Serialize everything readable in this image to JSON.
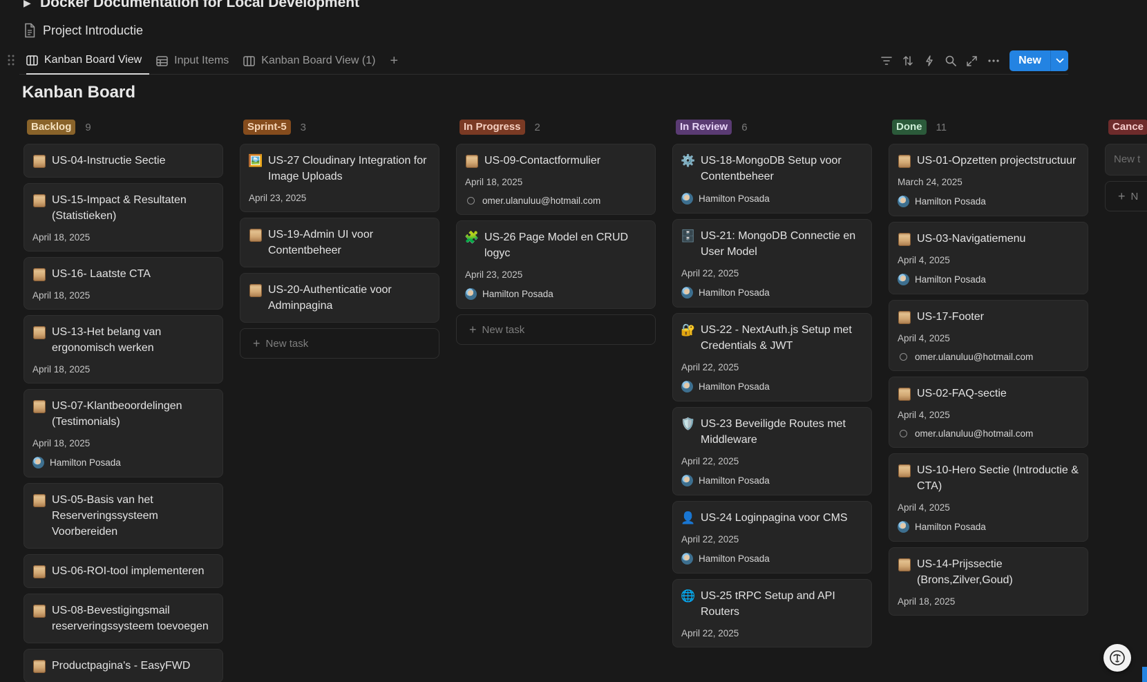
{
  "header": {
    "parent_title": "Docker Documentation for Local Development",
    "page_title": "Project Introductie"
  },
  "tabs": [
    {
      "label": "Kanban Board View",
      "icon": "board-icon",
      "active": true
    },
    {
      "label": "Input Items",
      "icon": "table-icon",
      "active": false
    },
    {
      "label": "Kanban Board View (1)",
      "icon": "board-icon",
      "active": false
    }
  ],
  "toolbar": {
    "new_label": "New",
    "tools": [
      "filter-icon",
      "sort-icon",
      "automation-icon",
      "search-icon",
      "expand-icon",
      "more-icon"
    ]
  },
  "board_title": "Kanban Board",
  "new_task_label": "New task",
  "new_task_short": "New t",
  "new_short": "N",
  "columns": [
    {
      "name": "Backlog",
      "count": "9",
      "badge_bg": "#89632a",
      "badge_fg": "#f5e2c0",
      "cards": [
        {
          "title": "US-04-Instructie Sectie",
          "icon": "scroll"
        },
        {
          "title": "US-15-Impact & Resultaten (Statistieken)",
          "icon": "scroll",
          "date": "April 18, 2025"
        },
        {
          "title": "US-16- Laatste CTA",
          "icon": "scroll",
          "date": "April 18, 2025"
        },
        {
          "title": "US-13-Het belang van ergonomisch werken",
          "icon": "scroll",
          "date": "April 18, 2025"
        },
        {
          "title": "US-07-Klantbeoordelingen (Testimonials)",
          "icon": "scroll",
          "date": "April 18, 2025",
          "person": "Hamilton Posada",
          "avatar": true
        },
        {
          "title": "US-05-Basis van het Reserveringssysteem Voorbereiden",
          "icon": "scroll"
        },
        {
          "title": "US-06-ROI-tool implementeren",
          "icon": "scroll"
        },
        {
          "title": "US-08-Bevestigingsmail reserveringssysteem toevoegen",
          "icon": "scroll"
        },
        {
          "title": "Productpagina's - EasyFWD",
          "icon": "scroll"
        }
      ]
    },
    {
      "name": "Sprint-5",
      "count": "3",
      "badge_bg": "#854c1d",
      "badge_fg": "#f6d6b8",
      "cards": [
        {
          "title": "US-27 Cloudinary Integration for Image Uploads",
          "icon": "picture",
          "date": "April 23, 2025"
        },
        {
          "title": "US-19-Admin UI voor Contentbeheer",
          "icon": "scroll"
        },
        {
          "title": "US-20-Authenticatie voor Adminpagina",
          "icon": "scroll"
        }
      ],
      "new_task": true
    },
    {
      "name": "In Progress",
      "count": "2",
      "badge_bg": "#7a3a24",
      "badge_fg": "#f5cfc0",
      "cards": [
        {
          "title": "US-09-Contactformulier",
          "icon": "scroll",
          "date": "April 18, 2025",
          "person": "omer.ulanuluu@hotmail.com",
          "avatar": false
        },
        {
          "title": "US-26 Page Model en CRUD logyc",
          "icon": "puzzle",
          "date": "April 23, 2025",
          "person": "Hamilton Posada",
          "avatar": true
        }
      ],
      "new_task": true
    },
    {
      "name": "In Review",
      "count": "6",
      "badge_bg": "#5a3b73",
      "badge_fg": "#e8d5f7",
      "cards": [
        {
          "title": "US-18-MongoDB Setup voor Contentbeheer",
          "icon": "gear",
          "person": "Hamilton Posada",
          "avatar": true
        },
        {
          "title": "US-21: MongoDB Connectie en User Model",
          "icon": "cabinet",
          "date": "April 22, 2025",
          "person": "Hamilton Posada",
          "avatar": true
        },
        {
          "title": "US-22 - NextAuth.js Setup met Credentials & JWT",
          "icon": "lock",
          "date": "April 22, 2025",
          "person": "Hamilton Posada",
          "avatar": true
        },
        {
          "title": "US-23 Beveiligde Routes met Middleware",
          "icon": "shield",
          "date": "April 22, 2025",
          "person": "Hamilton Posada",
          "avatar": true
        },
        {
          "title": "US-24 Loginpagina voor CMS",
          "icon": "user",
          "date": "April 22, 2025",
          "person": "Hamilton Posada",
          "avatar": true
        },
        {
          "title": "US-25 tRPC Setup and API Routers",
          "icon": "globe",
          "date": "April 22, 2025"
        }
      ]
    },
    {
      "name": "Done",
      "count": "11",
      "badge_bg": "#2b5a3a",
      "badge_fg": "#cdeed7",
      "cards": [
        {
          "title": "US-01-Opzetten projectstructuur",
          "icon": "scroll",
          "date": "March 24, 2025",
          "person": "Hamilton Posada",
          "avatar": true
        },
        {
          "title": "US-03-Navigatiemenu",
          "icon": "scroll",
          "date": "April 4, 2025",
          "person": "Hamilton Posada",
          "avatar": true
        },
        {
          "title": "US-17-Footer",
          "icon": "scroll",
          "date": "April 4, 2025",
          "person": "omer.ulanuluu@hotmail.com",
          "avatar": false
        },
        {
          "title": "US-02-FAQ-sectie",
          "icon": "scroll",
          "date": "April 4, 2025",
          "person": "omer.ulanuluu@hotmail.com",
          "avatar": false
        },
        {
          "title": "US-10-Hero Sectie (Introductie & CTA)",
          "icon": "scroll",
          "date": "April 4, 2025",
          "person": "Hamilton Posada",
          "avatar": true
        },
        {
          "title": "US-14-Prijssectie (Brons,Zilver,Goud)",
          "icon": "scroll",
          "date": "April 18, 2025"
        }
      ]
    },
    {
      "name": "Cance",
      "count": "",
      "badge_bg": "#6e2b2b",
      "badge_fg": "#f6cccc",
      "cards": [],
      "partial": true
    }
  ]
}
